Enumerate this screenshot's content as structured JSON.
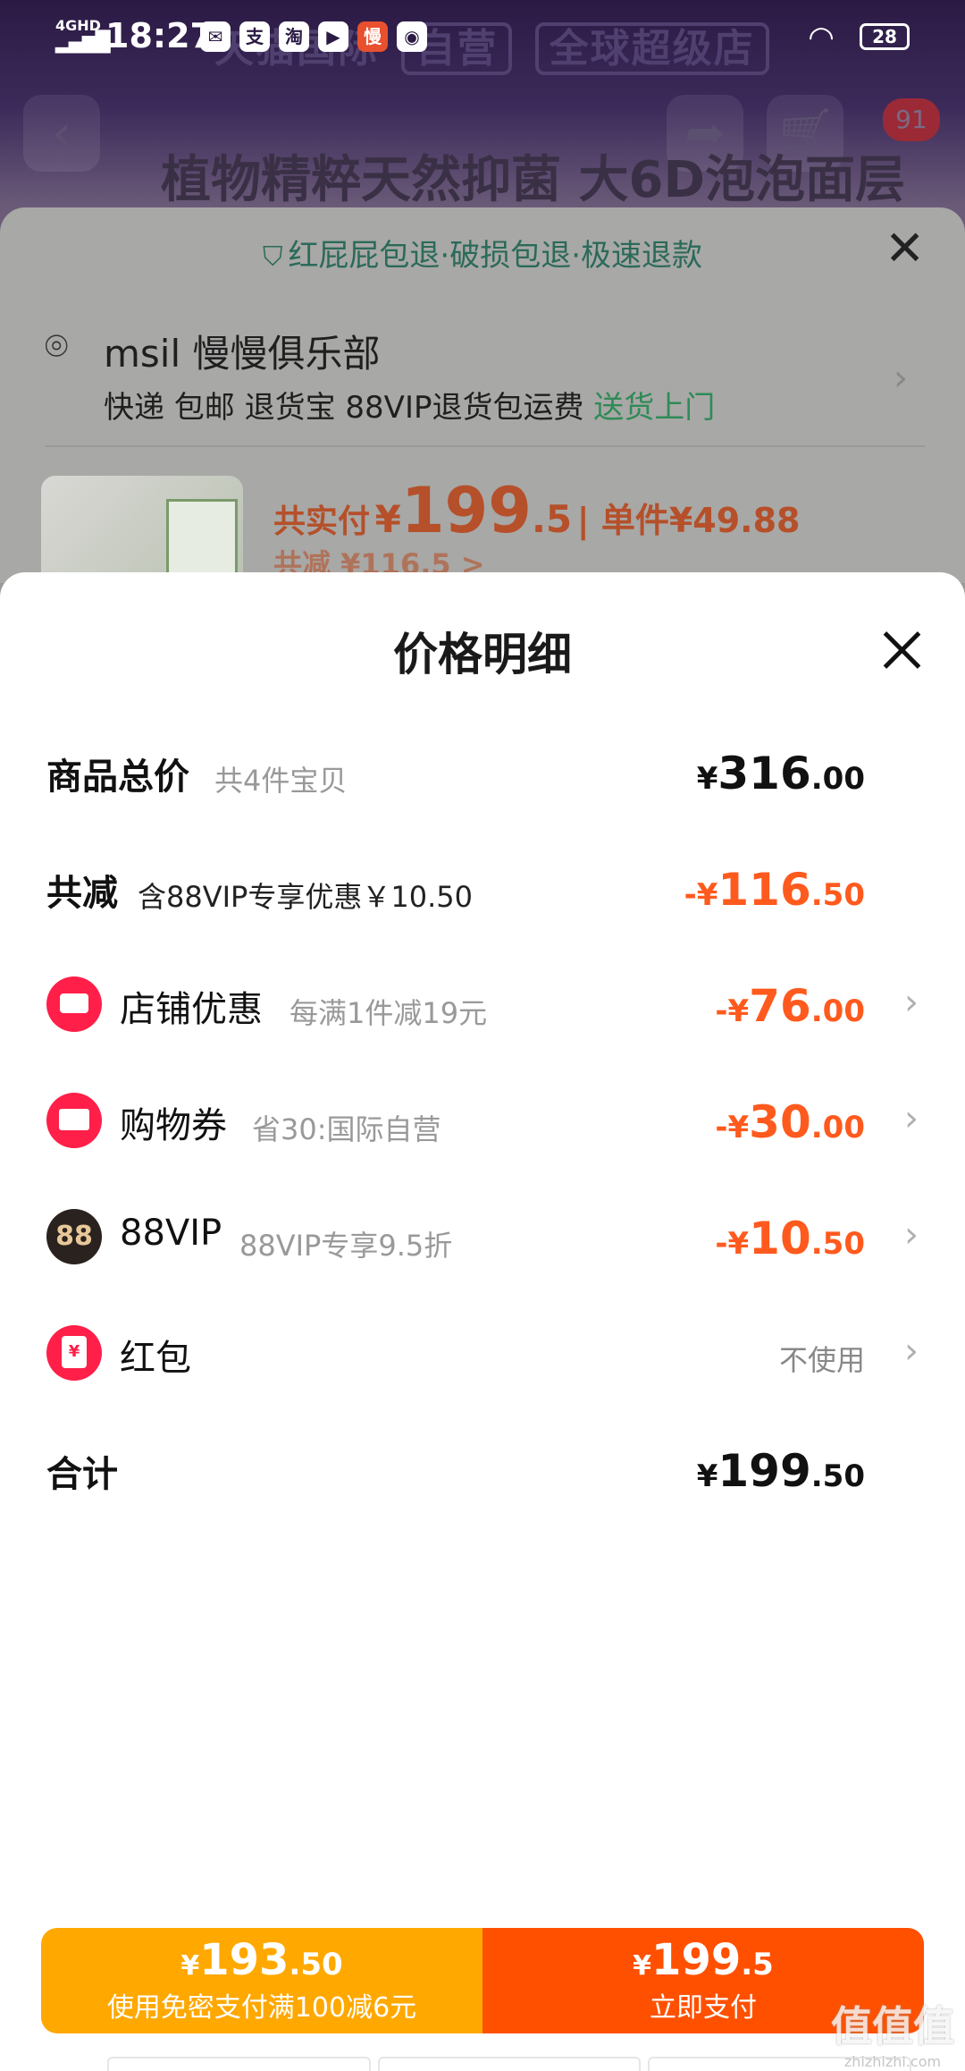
{
  "status_bar": {
    "network": "4GHD",
    "time": "18:27",
    "app_icons": [
      "mail-icon",
      "alipay-icon",
      "taobao-icon",
      "video-icon",
      "slow-icon",
      "weibo-icon"
    ],
    "battery": "28"
  },
  "background": {
    "store_banner": "天猫国际",
    "store_tag_1": "自营",
    "store_tag_2": "全球超级店",
    "cart_badge": "91",
    "product_title": "植物精粹天然抑菌 大6D泡泡面层"
  },
  "order_sheet": {
    "guarantee": "红屁屁包退·破损包退·极速退款",
    "address_name": "msil 慢慢俱乐部",
    "delivery_info": "快递 包邮 退货宝 88VIP退货包运费 ",
    "delivery_highlight": "送货上门",
    "paid_label": "共实付",
    "paid_symbol": "¥",
    "paid_int": "199",
    "paid_dec": ".5",
    "unit_price": "| 单件¥49.88",
    "reduced_partial": "共减 ¥116.5 >"
  },
  "modal": {
    "title": "价格明细",
    "rows": {
      "total": {
        "label": "商品总价",
        "sub": "共4件宝贝",
        "sym": "¥",
        "int": "316",
        "dec": ".00"
      },
      "reduced": {
        "label": "共减",
        "sub": "含88VIP专享优惠￥10.50",
        "sym": "-¥",
        "int": "116",
        "dec": ".50"
      },
      "store": {
        "label": "店铺优惠",
        "sub": "每满1件减19元",
        "sym": "-¥",
        "int": "76",
        "dec": ".00"
      },
      "coupon": {
        "label": "购物券",
        "sub": "省30:国际自营",
        "sym": "-¥",
        "int": "30",
        "dec": ".00"
      },
      "vip": {
        "label": "88VIP",
        "sub": "88VIP专享9.5折",
        "sym": "-¥",
        "int": "10",
        "dec": ".50",
        "icon_text": "88"
      },
      "red_packet": {
        "label": "红包",
        "value": "不使用",
        "icon_text": "¥"
      },
      "sum": {
        "label": "合计",
        "sym": "¥",
        "int": "199",
        "dec": ".50"
      }
    }
  },
  "pay_bar": {
    "left_sym": "¥",
    "left_int": "193",
    "left_dec": ".50",
    "left_caption": "使用免密支付满100减6元",
    "right_sym": "¥",
    "right_int": "199",
    "right_dec": ".5",
    "right_caption": "立即支付"
  },
  "watermark": {
    "main": "值值值",
    "sub": "zhizhizhi.com"
  },
  "colors": {
    "orange": "#ff5a1e",
    "pay_left": "#ffa800",
    "pay_right": "#ff5000",
    "icon_red": "#ff1f48"
  }
}
